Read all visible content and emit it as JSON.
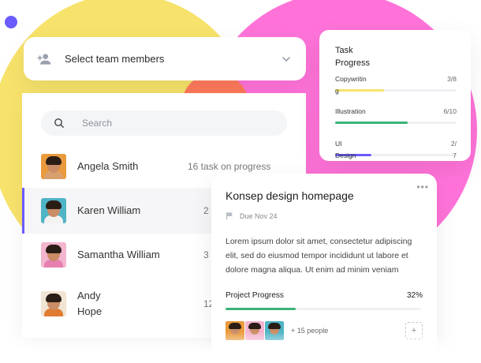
{
  "select": {
    "label": "Select team members",
    "icon": "add-person-icon",
    "chevron_icon": "chevron-down-icon"
  },
  "search": {
    "placeholder": "Search",
    "icon": "search-icon"
  },
  "members": [
    {
      "name": "Angela Smith",
      "task": "16 task on progress",
      "active": false,
      "avatar_bg": "#e99a3c",
      "shirt": "#d9a06d"
    },
    {
      "name": "Karen William",
      "task": "2",
      "active": true,
      "avatar_bg": "#4fb4c6",
      "shirt": "#f2f2f2"
    },
    {
      "name": "Samantha William",
      "task": "3",
      "active": false,
      "avatar_bg": "#f3b4cf",
      "shirt": "#e77fb0"
    },
    {
      "name": "Andy Hope",
      "task": "12",
      "active": false,
      "avatar_bg": "#f0e4d2",
      "shirt": "#e07c32"
    }
  ],
  "task_progress": {
    "title": "Task Progress",
    "items": [
      {
        "label": "Copywritin",
        "value": "3/8",
        "under": "g",
        "progress": 0.4,
        "color": "#f7e36b"
      },
      {
        "label": "Illustration",
        "value": "6/10",
        "under": "",
        "progress": 0.6,
        "color": "#3bb37a"
      },
      {
        "label": "UI",
        "value": "2/",
        "under": "Design",
        "progress": 0.3,
        "color": "#6a5cff",
        "under_value": "7"
      }
    ]
  },
  "task_card": {
    "title": "Konsep design homepage",
    "due": "Due Nov 24",
    "description": "Lorem ipsum dolor sit amet, consectetur adipiscing elit, sed do eiusmod tempor incididunt ut labore et dolore magna aliqua. Ut enim ad minim veniam",
    "progress_label": "Project Progress",
    "progress_text": "32%",
    "progress": 0.36,
    "people_text": "+ 15 people",
    "more_icon": "more-horizontal-icon",
    "add_label": "+"
  },
  "colors": {
    "yellow": "#f7e36b",
    "pink": "#ff73d9",
    "orange": "#ff7a5c",
    "purple": "#6a5cff",
    "green": "#3bb37a"
  }
}
